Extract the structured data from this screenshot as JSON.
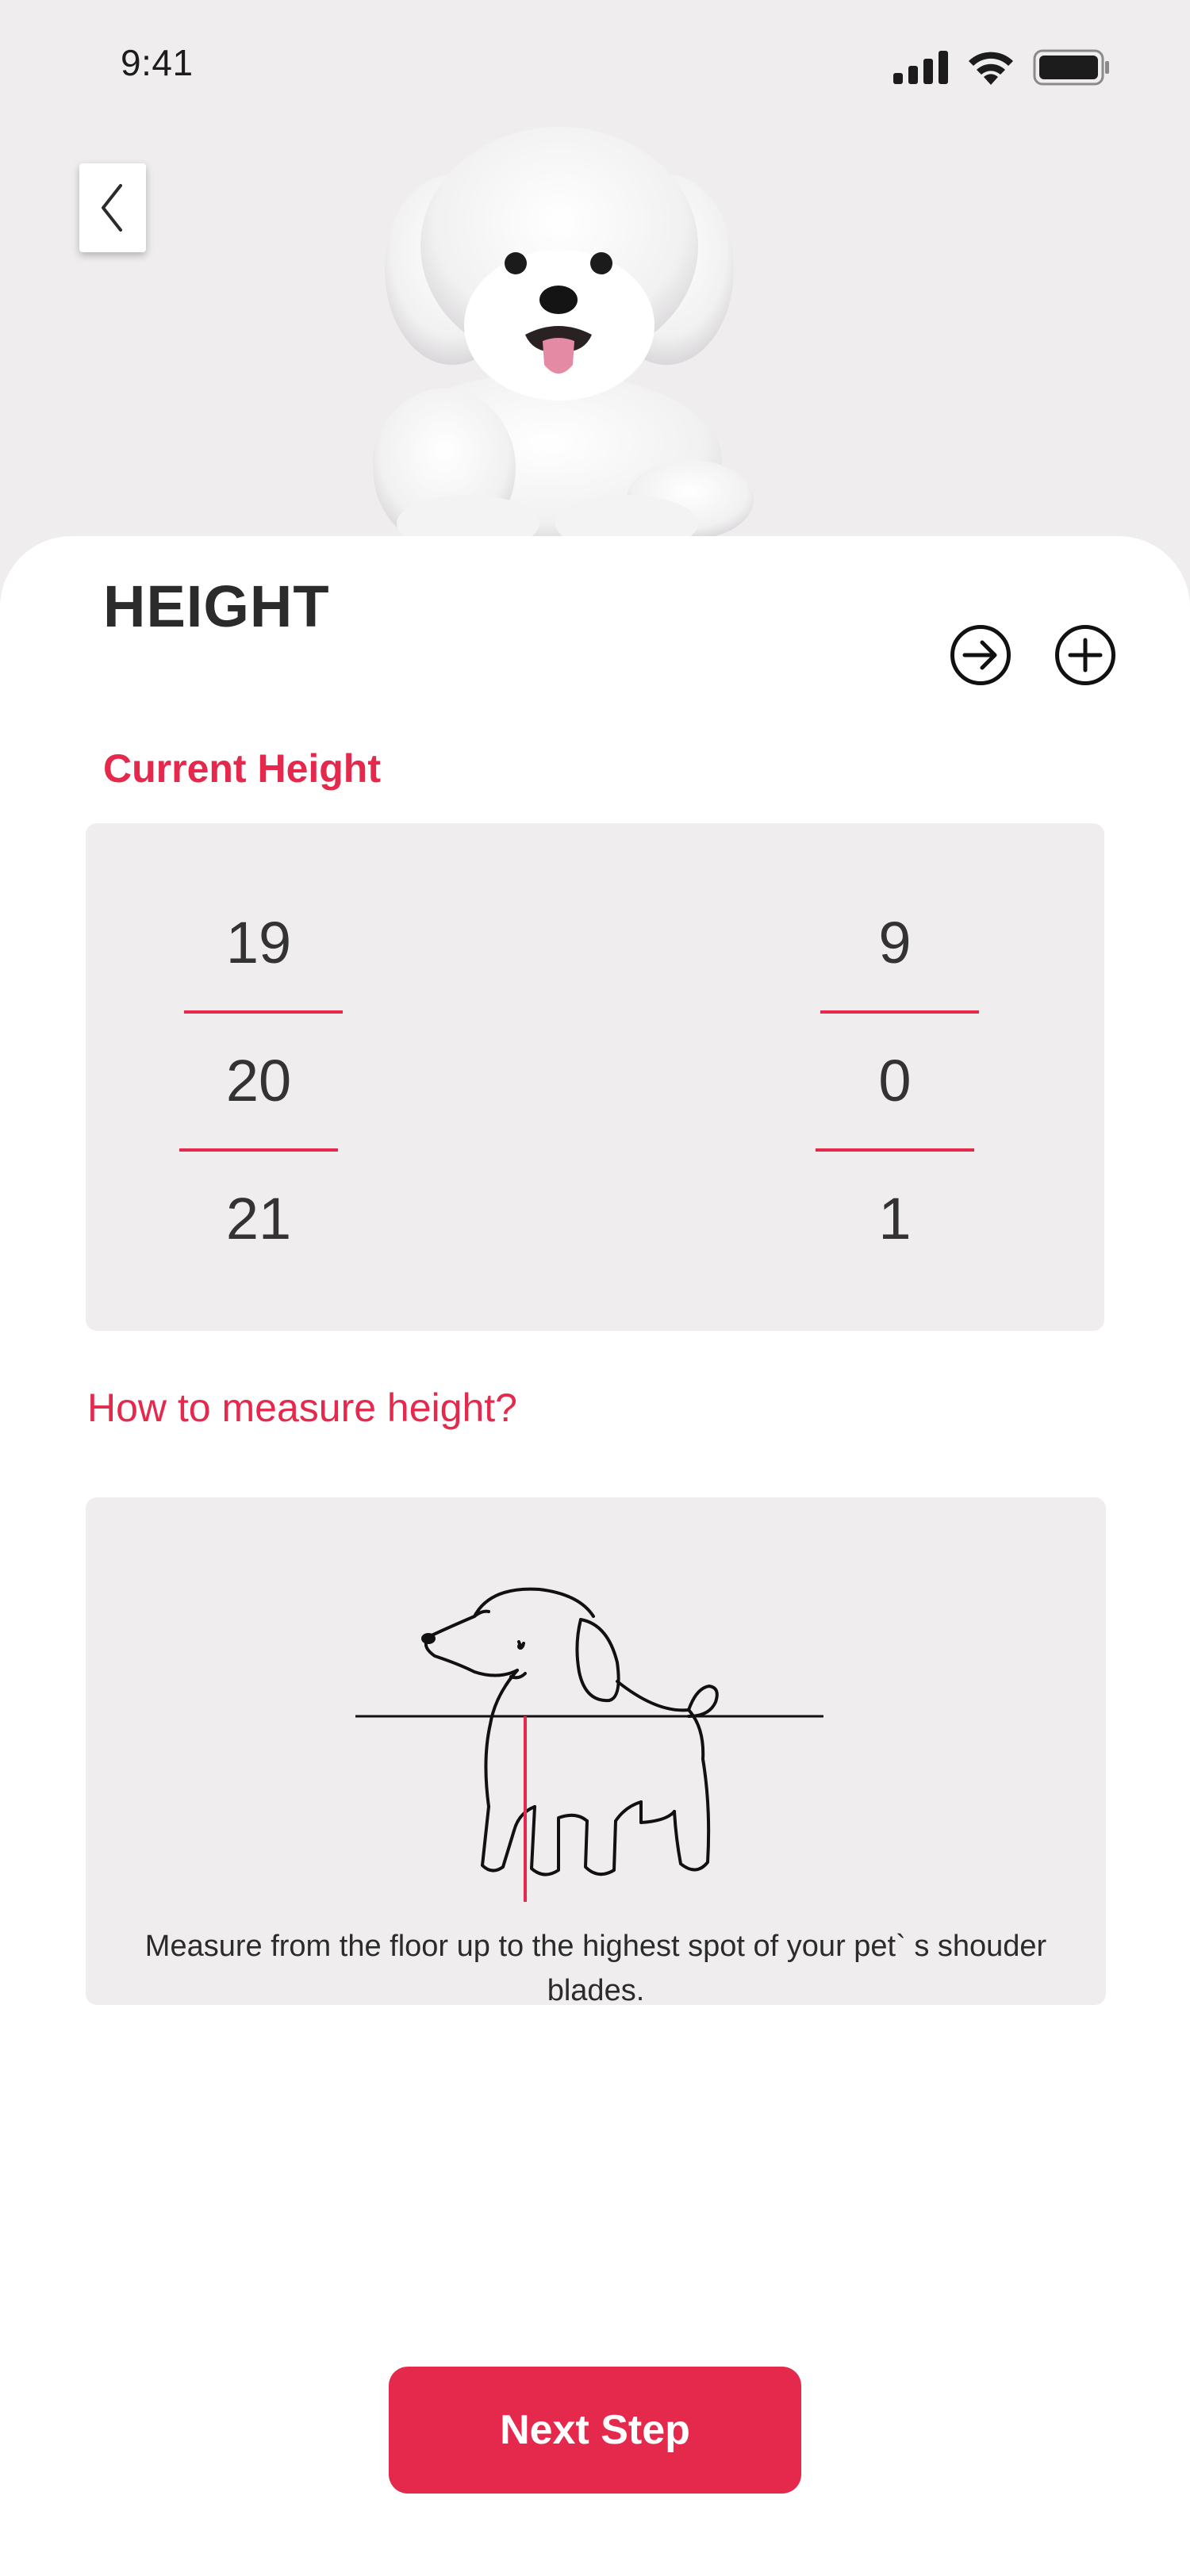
{
  "status_bar": {
    "time": "9:41",
    "icons": [
      "signal-icon",
      "wifi-icon",
      "battery-icon"
    ]
  },
  "header": {
    "back_icon": "chevron-left-icon",
    "title": "HEIGHT",
    "actions": [
      "arrow-right-circle-icon",
      "plus-circle-icon"
    ]
  },
  "current_height": {
    "label": "Current Height",
    "whole": {
      "above": "19",
      "selected": "20",
      "below": "21"
    },
    "fraction": {
      "above": "9",
      "selected": "0",
      "below": "1"
    }
  },
  "guide": {
    "link": "How to measure height?",
    "illustration": "dog-measure-illustration",
    "caption": "Measure from the floor up to the highest spot of your pet` s shouder blades."
  },
  "footer": {
    "next_label": "Next Step"
  },
  "colors": {
    "accent": "#e5294c",
    "background": "#efedee",
    "card": "#ffffff",
    "text": "#2b2b2b"
  }
}
